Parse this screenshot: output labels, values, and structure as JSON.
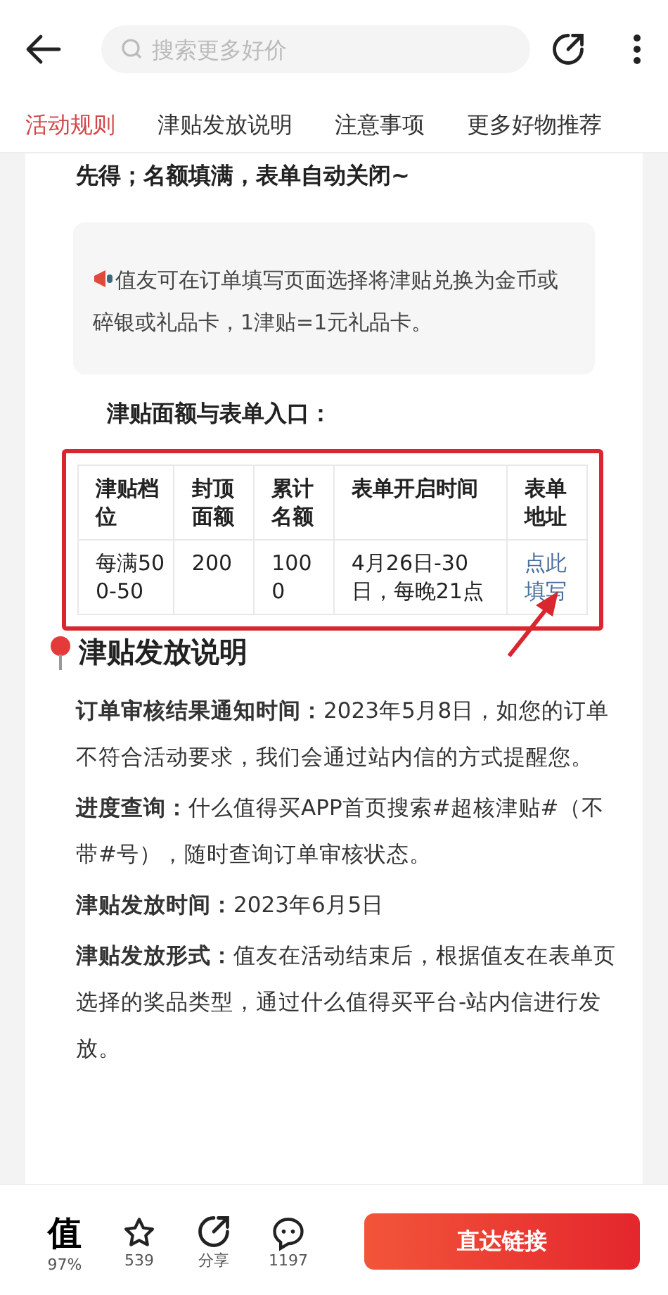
{
  "header": {
    "search": {
      "placeholder": "搜索更多好价"
    }
  },
  "tabs": [
    {
      "label": "活动规则",
      "selected": true
    },
    {
      "label": "津贴发放说明",
      "selected": false
    },
    {
      "label": "注意事项",
      "selected": false
    },
    {
      "label": "更多好物推荐",
      "selected": false
    }
  ],
  "intro_tail": "先得；名额填满，表单自动关闭~",
  "notice": "值友可在订单填写页面选择将津贴兑换为金币或碎银或礼品卡，1津贴=1元礼品卡。",
  "table_title": "津贴面额与表单入口：",
  "table": {
    "columns": [
      "津贴档位",
      "封顶面额",
      "累计名额",
      "表单开启时间",
      "表单地址"
    ],
    "rows": [
      {
        "cells": [
          "每满500-50",
          "200",
          "1000",
          "4月26日-30日，每晚21点"
        ],
        "link": "点此填写"
      }
    ]
  },
  "section": {
    "title": "津贴发放说明",
    "paragraphs": [
      "**订单审核结果通知时间：**2023年5月8日，如您的订单不符合活动要求，我们会通过站内信的方式提醒您。",
      "**进度查询：**什么值得买APP首页搜索#超核津贴#（不带#号），随时查询订单审核状态。",
      "**津贴发放时间：**2023年6月5日",
      "**津贴发放形式：**值友在活动结束后，根据值友在表单页选择的奖品类型，通过什么值得买平台-站内信进行发放。"
    ]
  },
  "bottom_bar": {
    "actions": [
      {
        "kind": "worth",
        "glyph": "值",
        "label": "97%"
      },
      {
        "kind": "star",
        "label": "539"
      },
      {
        "kind": "share",
        "label": "分享"
      },
      {
        "kind": "comment",
        "label": "1197"
      }
    ],
    "button": "直达链接"
  }
}
